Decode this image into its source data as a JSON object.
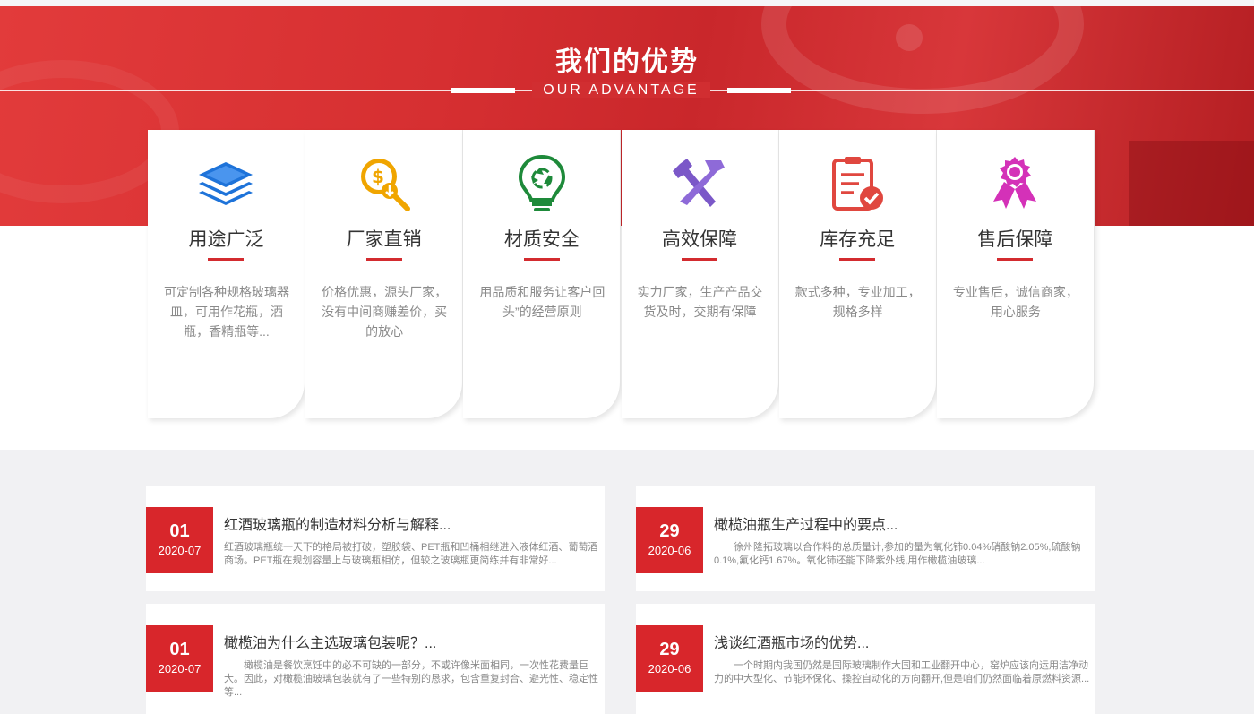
{
  "advantage": {
    "title": "我们的优势",
    "subtitle": "OUR ADVANTAGE",
    "cards": [
      {
        "icon": "stack-layers-icon",
        "title": "用途广泛",
        "desc": "可定制各种规格玻璃器皿，可用作花瓶，酒瓶，香精瓶等..."
      },
      {
        "icon": "dollar-search-icon",
        "title": "厂家直销",
        "desc": "价格优惠，源头厂家，没有中间商赚差价，买的放心"
      },
      {
        "icon": "recycle-bulb-icon",
        "title": "材质安全",
        "desc": "用品质和服务让客户回头”的经营原则"
      },
      {
        "icon": "tools-icon",
        "title": "高效保障",
        "desc": "实力厂家，生产产品交货及时，交期有保障"
      },
      {
        "icon": "checklist-icon",
        "title": "库存充足",
        "desc": "款式多种，专业加工，规格多样"
      },
      {
        "icon": "award-ribbon-icon",
        "title": "售后保障",
        "desc": "专业售后，诚信商家，用心服务"
      }
    ]
  },
  "news": [
    {
      "day": "01",
      "ym": "2020-07",
      "title": "红酒玻璃瓶的制造材料分析与解释...",
      "desc": "红酒玻璃瓶统一天下的格局被打破，塑胶袋、PET瓶和凹桶相继进入液体红酒、葡萄酒商场。PET瓶在规划容量上与玻璃瓶相仿，但较之玻璃瓶更简练并有非常好..."
    },
    {
      "day": "29",
      "ym": "2020-06",
      "title": "橄榄油瓶生产过程中的要点...",
      "desc": "徐州隆拓玻璃以合作料的总质量计,参加的量为氧化铈0.04%硝酸钠2.05%,硫酸钠0.1%,氟化钙1.67%。氧化铈还能下降紫外线,用作橄榄油玻璃..."
    },
    {
      "day": "01",
      "ym": "2020-07",
      "title": "橄榄油为什么主选玻璃包装呢？...",
      "desc": "橄榄油是餐饮烹饪中的必不可缺的一部分，不或许像米面相同，一次性花费量巨大。因此，对橄榄油玻璃包装就有了一些特别的恳求，包含重复封合、避光性、稳定性等..."
    },
    {
      "day": "29",
      "ym": "2020-06",
      "title": "浅谈红酒瓶市场的优势...",
      "desc": "一个时期内我国仍然是国际玻璃制作大国和工业翻开中心，窑炉应该向运用洁净动力的中大型化、节能环保化、操控自动化的方向翻开,但是咱们仍然面临着原燃料资源..."
    }
  ]
}
